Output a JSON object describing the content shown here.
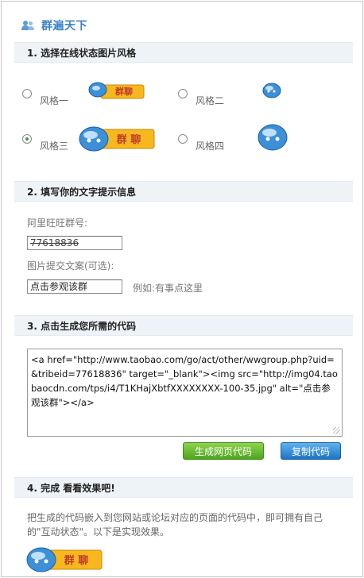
{
  "header": {
    "title": "群遍天下",
    "icon": "people-icon"
  },
  "sections": {
    "s1": "1. 选择在线状态图片风格",
    "s2": "2. 填写你的文字提示信息",
    "s3": "3. 点击生成您所需的代码",
    "s4": "4. 完成 看看效果吧!"
  },
  "styles": [
    {
      "label": "风格一",
      "checked": false,
      "badge_text": "群聊"
    },
    {
      "label": "风格二",
      "checked": false
    },
    {
      "label": "风格三",
      "checked": true,
      "badge_text": "群 聊"
    },
    {
      "label": "风格四",
      "checked": false
    }
  ],
  "form": {
    "group_label": "阿里旺旺群号:",
    "group_value": "77618836",
    "caption_label": "图片提交文案(可选):",
    "caption_value": "点击参观该群",
    "caption_hint": "例如:有事点这里"
  },
  "code": {
    "text": "<a href=\"http://www.taobao.com/go/act/other/wwgroup.php?uid=&tribeid=77618836\" target=\"_blank\"><img src=\"http://img04.taobaocdn.com/tps/i4/T1KHajXbtfXXXXXXXX-100-35.jpg\" alt=\"点击参观该群\"></a>"
  },
  "buttons": {
    "generate": "生成网页代码",
    "copy": "复制代码"
  },
  "result": {
    "description": "把生成的代码嵌入到您网站或论坛对应的页面的代码中，即可拥有自己的\"互动状态\"。以下是实现效果。",
    "badge_text": "群 聊"
  },
  "colors": {
    "accent_blue": "#3b82c4",
    "badge_orange": "#f6b81e",
    "button_green": "#4ea51f",
    "button_blue": "#1e74c4"
  }
}
